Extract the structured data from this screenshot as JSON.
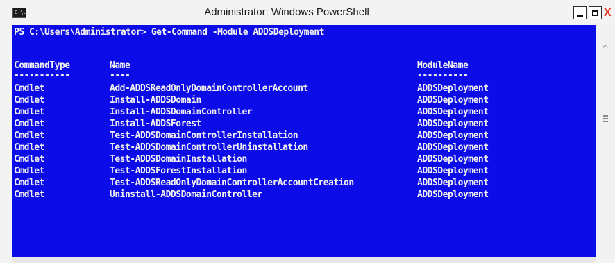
{
  "window": {
    "title": "Administrator: Windows PowerShell",
    "icon_text": "C:\\.",
    "close_label": "X"
  },
  "console": {
    "prompt_line": "PS C:\\Users\\Administrator> Get-Command -Module ADDSDeployment",
    "headers": [
      "CommandType",
      "Name",
      "ModuleName"
    ],
    "underlines": [
      "-----------",
      "----",
      "----------"
    ],
    "rows": [
      [
        "Cmdlet",
        "Add-ADDSReadOnlyDomainControllerAccount",
        "ADDSDeployment"
      ],
      [
        "Cmdlet",
        "Install-ADDSDomain",
        "ADDSDeployment"
      ],
      [
        "Cmdlet",
        "Install-ADDSDomainController",
        "ADDSDeployment"
      ],
      [
        "Cmdlet",
        "Install-ADDSForest",
        "ADDSDeployment"
      ],
      [
        "Cmdlet",
        "Test-ADDSDomainControllerInstallation",
        "ADDSDeployment"
      ],
      [
        "Cmdlet",
        "Test-ADDSDomainControllerUninstallation",
        "ADDSDeployment"
      ],
      [
        "Cmdlet",
        "Test-ADDSDomainInstallation",
        "ADDSDeployment"
      ],
      [
        "Cmdlet",
        "Test-ADDSForestInstallation",
        "ADDSDeployment"
      ],
      [
        "Cmdlet",
        "Test-ADDSReadOnlyDomainControllerAccountCreation",
        "ADDSDeployment"
      ],
      [
        "Cmdlet",
        "Uninstall-ADDSDomainController",
        "ADDSDeployment"
      ]
    ],
    "background_color": "#0c0ce8",
    "text_color": "#f0f0f0"
  },
  "scrollbar": {
    "up_arrow": "^",
    "icons": [
      "scroll-up-icon",
      "scroll-grip-icon"
    ]
  }
}
